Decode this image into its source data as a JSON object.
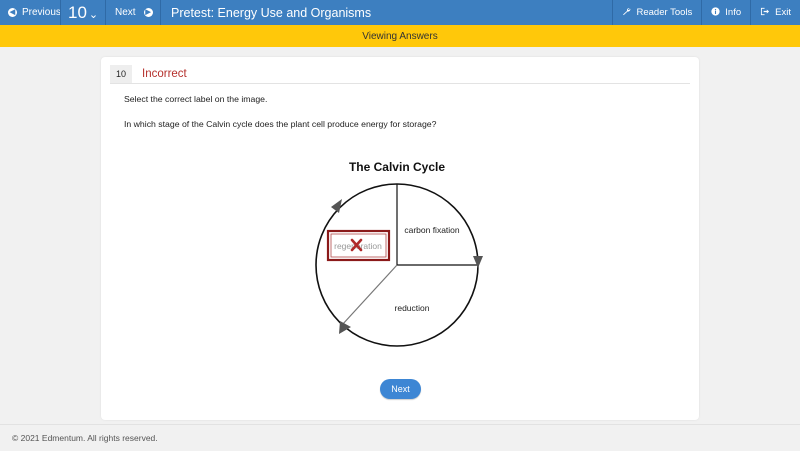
{
  "nav": {
    "previous_label": "Previous",
    "question_number": "10",
    "next_label": "Next",
    "title": "Pretest: Energy Use and Organisms",
    "tools": [
      {
        "label": "Reader Tools",
        "icon": "wrench-icon"
      },
      {
        "label": "Info",
        "icon": "info-icon"
      },
      {
        "label": "Exit",
        "icon": "exit-icon"
      }
    ]
  },
  "banner": {
    "text": "Viewing Answers"
  },
  "question": {
    "number": "10",
    "status": "Incorrect",
    "instruction": "Select the correct label on the image.",
    "text": "In which stage of the Calvin cycle does the plant cell produce energy for storage?"
  },
  "diagram": {
    "title": "The Calvin Cycle",
    "labels": {
      "regeneration": "regeneration",
      "carbon_fixation": "carbon fixation",
      "reduction": "reduction"
    },
    "selected_label": "regeneration",
    "selection_result": "incorrect"
  },
  "next_button": {
    "label": "Next"
  },
  "footer": {
    "text": "© 2021 Edmentum. All rights reserved."
  },
  "colors": {
    "nav_bg": "#3d7fc0",
    "banner_bg": "#ffc80a",
    "incorrect": "#b5302c",
    "selection_border": "#8b1a1a",
    "button": "#3d86d4"
  }
}
